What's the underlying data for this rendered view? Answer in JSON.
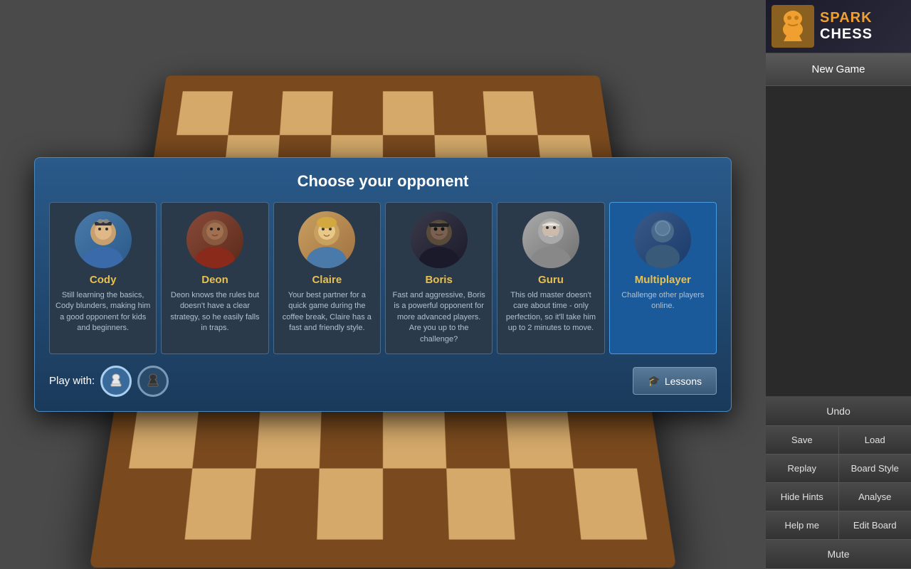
{
  "brand": {
    "name_line1": "SPARK",
    "name_line2": "CHESS",
    "logo_icon": "♞"
  },
  "dialog": {
    "title": "Choose your opponent",
    "play_with_label": "Play with:",
    "lessons_btn": "Lessons"
  },
  "opponents": [
    {
      "id": "cody",
      "name": "Cody",
      "desc": "Still learning the basics, Cody blunders, making him a good opponent for kids and beginners.",
      "selected": false
    },
    {
      "id": "deon",
      "name": "Deon",
      "desc": "Deon knows the rules but doesn't have a clear strategy, so he easily falls in traps.",
      "selected": false
    },
    {
      "id": "claire",
      "name": "Claire",
      "desc": "Your best partner for a quick game during the coffee break, Claire has a fast and friendly style.",
      "selected": false
    },
    {
      "id": "boris",
      "name": "Boris",
      "desc": "Fast and aggressive, Boris is a powerful opponent for more advanced players. Are you up to the challenge?",
      "selected": false
    },
    {
      "id": "guru",
      "name": "Guru",
      "desc": "This old master doesn't care about time - only perfection, so it'll take him up to 2 minutes to move.",
      "selected": false
    },
    {
      "id": "multiplayer",
      "name": "Multiplayer",
      "desc": "Challenge other players online.",
      "selected": true
    }
  ],
  "sidebar": {
    "new_game": "New Game",
    "undo": "Undo",
    "save": "Save",
    "load": "Load",
    "replay": "Replay",
    "board_style": "Board Style",
    "hide_hints": "Hide Hints",
    "analyse": "Analyse",
    "help_me": "Help me",
    "edit_board": "Edit Board",
    "mute": "Mute"
  }
}
